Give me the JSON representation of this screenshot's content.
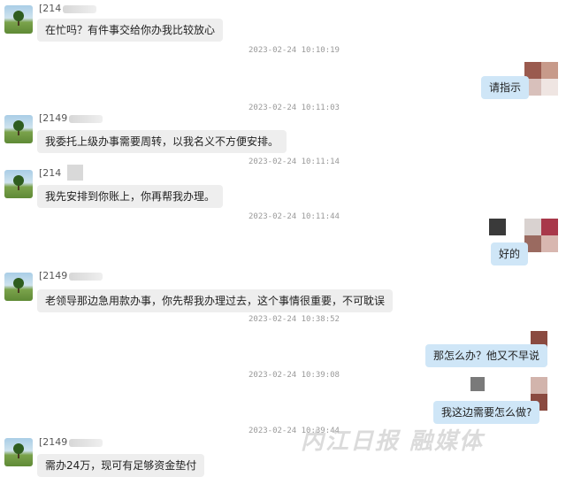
{
  "messages": [
    {
      "side": "left",
      "sender": "[214",
      "text": "在忙吗？有件事交给你办我比较放心",
      "time": "2023-02-24 10:10:19"
    },
    {
      "side": "right",
      "text": "请指示",
      "time": "2023-02-24 10:11:03"
    },
    {
      "side": "left",
      "sender": "[2149",
      "text": "我委托上级办事需要周转，以我名义不方便安排。",
      "time": "2023-02-24 10:11:14"
    },
    {
      "side": "left",
      "sender": "[214",
      "text": "我先安排到你账上，你再帮我办理。",
      "time": "2023-02-24 10:11:44"
    },
    {
      "side": "right",
      "text": "好的"
    },
    {
      "side": "left",
      "sender": "[2149",
      "text": "老领导那边急用款办事，你先帮我办理过去，这个事情很重要，不可耽误",
      "time": "2023-02-24 10:38:52"
    },
    {
      "side": "right",
      "text": "那怎么办？他又不早说",
      "time": "2023-02-24 10:39:08"
    },
    {
      "side": "right",
      "text": "我这边需要怎么做?",
      "time": "2023-02-24 10:39:44"
    },
    {
      "side": "left",
      "sender": "[2149",
      "text": "需办24万，现可有足够资金垫付"
    }
  ],
  "watermark": "内江日报 融媒体",
  "colors": {
    "left_bubble": "#eeeeee",
    "right_bubble": "#cfe6f7",
    "timestamp": "#999999"
  }
}
